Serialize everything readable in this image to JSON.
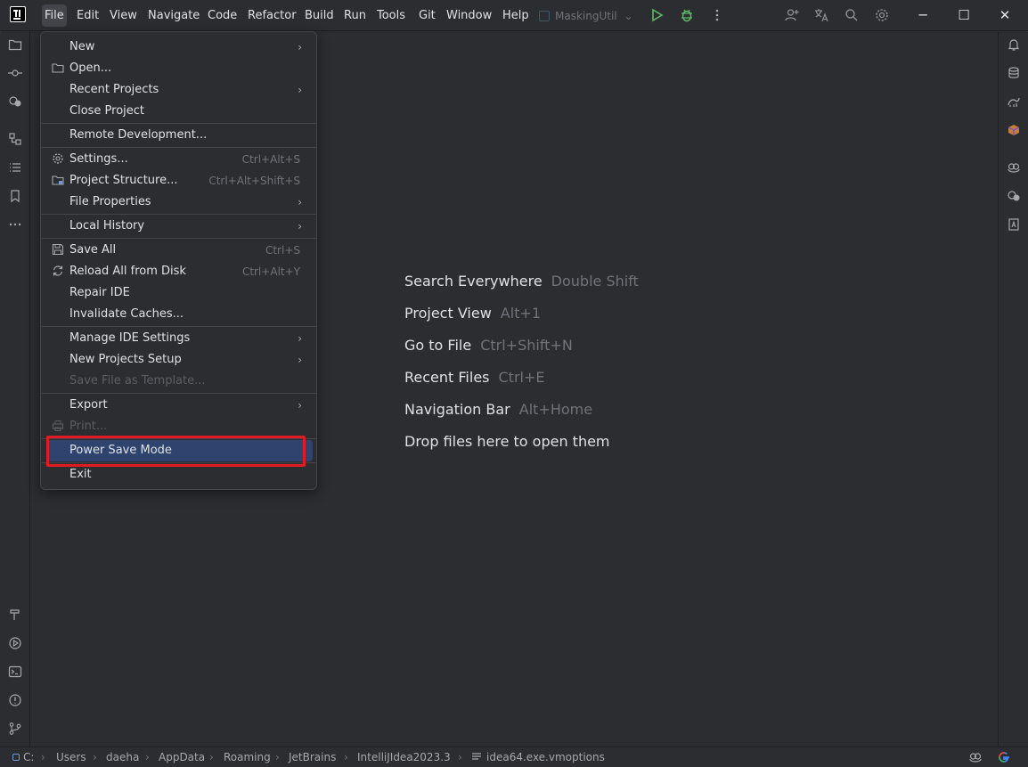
{
  "menubar": {
    "items": [
      {
        "label": "File",
        "active": true
      },
      {
        "label": "Edit"
      },
      {
        "label": "View"
      },
      {
        "label": "Navigate"
      },
      {
        "label": "Code"
      },
      {
        "label": "Refactor"
      },
      {
        "label": "Build"
      },
      {
        "label": "Run"
      },
      {
        "label": "Tools"
      },
      {
        "label": "Git"
      },
      {
        "label": "Window"
      },
      {
        "label": "Help"
      }
    ]
  },
  "run_config": {
    "name": "MaskingUtil",
    "dropdown_glyph": "⌄"
  },
  "toolbar_icons": [
    "run-icon",
    "debug-icon",
    "more-icon",
    "add-user-icon",
    "translate-icon",
    "search-icon",
    "settings-icon"
  ],
  "window_controls": {
    "minimize": "─",
    "maximize": "☐",
    "close": "✕"
  },
  "file_menu": {
    "items": [
      {
        "label": "New",
        "submenu": true
      },
      {
        "label": "Open...",
        "icon": "folder-icon"
      },
      {
        "label": "Recent Projects",
        "submenu": true
      },
      {
        "label": "Close Project"
      },
      {
        "label": "Remote Development..."
      },
      {
        "label": "Settings...",
        "shortcut": "Ctrl+Alt+S",
        "icon": "gear-icon"
      },
      {
        "label": "Project Structure...",
        "shortcut": "Ctrl+Alt+Shift+S",
        "icon": "project-structure-icon"
      },
      {
        "label": "File Properties",
        "submenu": true
      },
      {
        "label": "Local History",
        "submenu": true
      },
      {
        "label": "Save All",
        "shortcut": "Ctrl+S",
        "icon": "save-icon"
      },
      {
        "label": "Reload All from Disk",
        "shortcut": "Ctrl+Alt+Y",
        "icon": "reload-icon"
      },
      {
        "label": "Repair IDE"
      },
      {
        "label": "Invalidate Caches..."
      },
      {
        "label": "Manage IDE Settings",
        "submenu": true
      },
      {
        "label": "New Projects Setup",
        "submenu": true
      },
      {
        "label": "Save File as Template...",
        "disabled": true
      },
      {
        "label": "Export",
        "submenu": true
      },
      {
        "label": "Print...",
        "disabled": true,
        "icon": "print-icon"
      },
      {
        "label": "Power Save Mode",
        "selected": true
      },
      {
        "label": "Exit"
      }
    ],
    "arrow": "›"
  },
  "editor_hints": [
    {
      "label": "Search Everywhere",
      "key": "Double Shift"
    },
    {
      "label": "Project View",
      "key": "Alt+1"
    },
    {
      "label": "Go to File",
      "key": "Ctrl+Shift+N"
    },
    {
      "label": "Recent Files",
      "key": "Ctrl+E"
    },
    {
      "label": "Navigation Bar",
      "key": "Alt+Home"
    },
    {
      "label": "Drop files here to open them",
      "key": ""
    }
  ],
  "statusbar": {
    "breadcrumbs": [
      "C:",
      "Users",
      "daeha",
      "AppData",
      "Roaming",
      "JetBrains",
      "IntelliJIdea2023.3",
      "idea64.exe.vmoptions"
    ],
    "separator": "›"
  },
  "colors": {
    "background": "#2b2d30",
    "selection": "#2e436e",
    "highlight_box": "#e01b24",
    "run_green": "#5fb865"
  }
}
